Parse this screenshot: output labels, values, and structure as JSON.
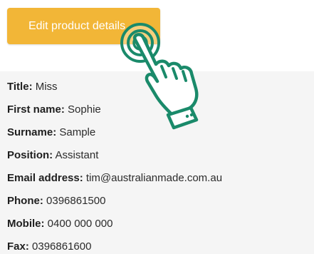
{
  "edit_button": {
    "label": "Edit product details"
  },
  "details": [
    {
      "label": "Title:",
      "value": "Miss"
    },
    {
      "label": "First name:",
      "value": "Sophie"
    },
    {
      "label": "Surname:",
      "value": "Sample"
    },
    {
      "label": "Position:",
      "value": "Assistant"
    },
    {
      "label": "Email address:",
      "value": "tim@australianmade.com.au"
    },
    {
      "label": "Phone:",
      "value": "0396861500"
    },
    {
      "label": "Mobile:",
      "value": "0400 000 000"
    },
    {
      "label": "Fax:",
      "value": "0396861600"
    }
  ],
  "colors": {
    "button": "#f2b637",
    "panel": "#f5f5f5",
    "hand_stroke": "#1a8a6a"
  },
  "icons": {
    "pointer": "tap-hand-icon"
  }
}
